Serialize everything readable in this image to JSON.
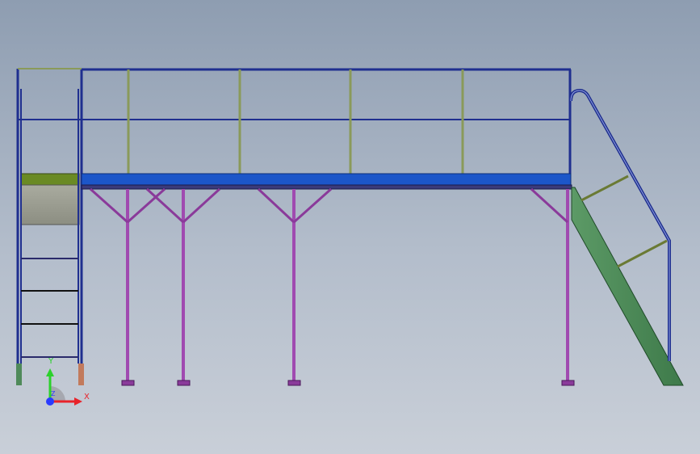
{
  "colors": {
    "background_top": "#8e9db1",
    "background_bottom": "#c9cfd8",
    "railing": "#1f2f8f",
    "railing_highlight": "#8a9a5a",
    "deck": "#1c56c9",
    "beam": "#2a2a6a",
    "post": "#a04ab0",
    "post_highlight": "#e6b0ea",
    "stair_stringer": "#4f8a5a",
    "ladder_landing": "#9b9d8f",
    "ladder_landing_top": "#6a8a24",
    "axis_x": "#e8232a",
    "axis_y": "#2bd12b",
    "axis_z": "#2a3bff"
  },
  "triad": {
    "x_label": "X",
    "y_label": "Y",
    "z_label": "Z"
  },
  "icons": {
    "triad": "coordinate-triad-icon"
  }
}
